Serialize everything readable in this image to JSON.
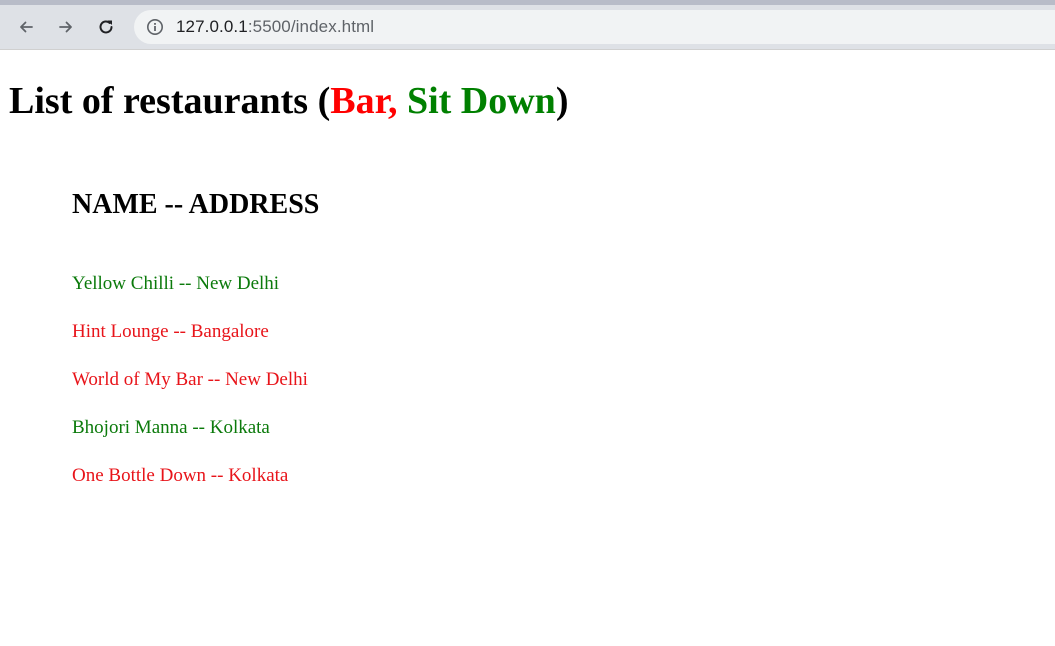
{
  "browser": {
    "url_host": "127.0.0.1",
    "url_rest": ":5500/index.html",
    "back_icon": "arrow-left-icon",
    "forward_icon": "arrow-right-icon",
    "reload_icon": "reload-icon",
    "info_icon": "info-icon"
  },
  "page": {
    "title_prefix": "List of restaurants (",
    "title_bar": "Bar,",
    "title_space": " ",
    "title_sitdown": "Sit Down",
    "title_suffix": ")",
    "list_header": "NAME -- ADDRESS",
    "restaurants": [
      {
        "text": "Yellow Chilli -- New Delhi",
        "color": "#0b7a0b"
      },
      {
        "text": "Hint Lounge -- Bangalore",
        "color": "#e8141a"
      },
      {
        "text": "World of My Bar -- New Delhi",
        "color": "#e8141a"
      },
      {
        "text": "Bhojori Manna -- Kolkata",
        "color": "#0b7a0b"
      },
      {
        "text": "One Bottle Down -- Kolkata",
        "color": "#e8141a"
      }
    ]
  },
  "colors": {
    "bar": "#ff0000",
    "sit_down": "#008000"
  }
}
